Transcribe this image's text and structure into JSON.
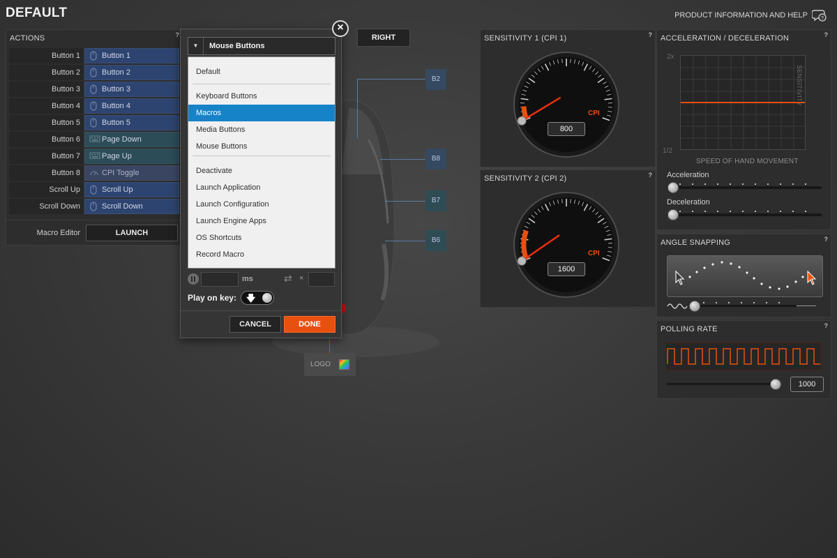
{
  "header": {
    "title": "DEFAULT",
    "help_link": "PRODUCT INFORMATION AND HELP"
  },
  "actions": {
    "title": "ACTIONS",
    "help": "?",
    "rows": [
      {
        "name": "Button 1",
        "value": "Button 1",
        "style": "blue",
        "icon": "mouse-icon"
      },
      {
        "name": "Button 2",
        "value": "Button 2",
        "style": "blue",
        "icon": "mouse-icon"
      },
      {
        "name": "Button 3",
        "value": "Button 3",
        "style": "blue",
        "icon": "mouse-icon"
      },
      {
        "name": "Button 4",
        "value": "Button 4",
        "style": "blue",
        "icon": "mouse-icon"
      },
      {
        "name": "Button 5",
        "value": "Button 5",
        "style": "blue",
        "icon": "mouse-icon"
      },
      {
        "name": "Button 6",
        "value": "Page Down",
        "style": "teal",
        "icon": "keyboard-icon"
      },
      {
        "name": "Button 7",
        "value": "Page Up",
        "style": "teal",
        "icon": "keyboard-icon"
      },
      {
        "name": "Button 8",
        "value": "CPI Toggle",
        "style": "gray",
        "icon": "gauge-icon"
      },
      {
        "name": "Scroll Up",
        "value": "Scroll Up",
        "style": "blue",
        "icon": "mouse-icon"
      },
      {
        "name": "Scroll Down",
        "value": "Scroll Down",
        "style": "blue",
        "icon": "mouse-icon"
      }
    ],
    "macro_editor_label": "Macro Editor",
    "launch_label": "LAUNCH"
  },
  "mouse": {
    "side_tab": "RIGHT",
    "tags": {
      "b2": "B2",
      "b8": "B8",
      "b7": "B7",
      "b6": "B6"
    },
    "logo_label": "LOGO"
  },
  "dialog": {
    "dropdown_label": "Mouse Buttons",
    "options": [
      {
        "label": "Default",
        "selected": false
      },
      {
        "label": "Keyboard Buttons",
        "selected": false
      },
      {
        "label": "Macros",
        "selected": true
      },
      {
        "label": "Media Buttons",
        "selected": false
      },
      {
        "label": "Mouse Buttons",
        "selected": false
      },
      {
        "label": "Deactivate",
        "selected": false
      },
      {
        "label": "Launch Application",
        "selected": false
      },
      {
        "label": "Launch Configuration",
        "selected": false
      },
      {
        "label": "Launch Engine Apps",
        "selected": false
      },
      {
        "label": "OS Shortcuts",
        "selected": false
      },
      {
        "label": "Record Macro",
        "selected": false
      }
    ],
    "delay_value": "",
    "delay_unit": "ms",
    "repeat_symbol": "×",
    "repeat_value": "",
    "play_on_key_label": "Play on key:",
    "cancel_label": "CANCEL",
    "done_label": "DONE",
    "close_symbol": "×"
  },
  "sensitivity1": {
    "title": "SENSITIVITY 1 (CPI 1)",
    "help": "?",
    "unit": "CPI",
    "value": "800",
    "level": 0.08
  },
  "sensitivity2": {
    "title": "SENSITIVITY 2 (CPI 2)",
    "help": "?",
    "unit": "CPI",
    "value": "1600",
    "level": 0.18
  },
  "acceleration": {
    "title": "ACCELERATION / DECELERATION",
    "help": "?",
    "y_top": "2x",
    "y_bottom": "1/2",
    "x_label": "SPEED OF HAND MOVEMENT",
    "y_label": "SENSITIVITY",
    "acceleration_label": "Acceleration",
    "acceleration_level": 0.0,
    "deceleration_label": "Deceleration",
    "deceleration_level": 0.0
  },
  "angle_snapping": {
    "title": "ANGLE SNAPPING",
    "help": "?",
    "level": 0.0
  },
  "polling": {
    "title": "POLLING RATE",
    "help": "?",
    "value": "1000",
    "level": 1.0
  },
  "colors": {
    "accent_orange": "#e8500f",
    "selection_blue": "#1683c9",
    "action_blue": "#2e4470",
    "action_teal": "#2c4c58"
  }
}
